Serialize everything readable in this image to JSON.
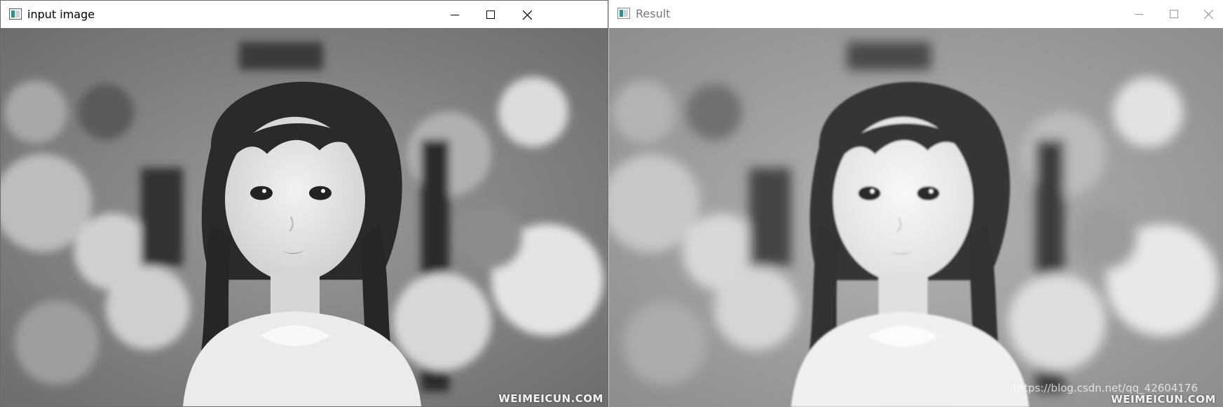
{
  "windows": [
    {
      "title": "input image",
      "active": true,
      "watermark": "WEIMEICUN.COM",
      "controls": {
        "minimize": "minimize",
        "maximize": "maximize",
        "close": "close"
      }
    },
    {
      "title": "Result",
      "active": false,
      "watermark": "WEIMEICUN.COM",
      "csdn_watermark": "https://blog.csdn.net/qq_42604176",
      "controls": {
        "minimize": "minimize",
        "maximize": "maximize",
        "close": "close"
      }
    }
  ],
  "colors": {
    "title_active": "#000000",
    "title_inactive": "#7a7a7a",
    "icon_teal": "#2f8f8a"
  },
  "icons": [
    "app-icon",
    "minimize-icon",
    "maximize-icon",
    "close-icon"
  ]
}
